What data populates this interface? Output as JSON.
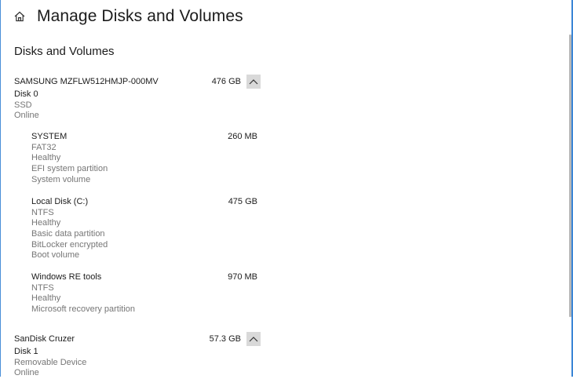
{
  "header": {
    "title": "Manage Disks and Volumes",
    "home_icon": "home-icon"
  },
  "section": {
    "title": "Disks and Volumes"
  },
  "disks": [
    {
      "name": "SAMSUNG MZFLW512HMJP-000MV",
      "size": "476 GB",
      "label": "Disk 0",
      "type": "SSD",
      "status": "Online",
      "volumes": [
        {
          "name": "SYSTEM",
          "size": "260 MB",
          "details": [
            "FAT32",
            "Healthy",
            "EFI system partition",
            "System volume"
          ]
        },
        {
          "name": "Local Disk (C:)",
          "size": "475 GB",
          "details": [
            "NTFS",
            "Healthy",
            "Basic data partition",
            "BitLocker encrypted",
            "Boot volume"
          ]
        },
        {
          "name": "Windows RE tools",
          "size": "970 MB",
          "details": [
            "NTFS",
            "Healthy",
            "Microsoft recovery partition"
          ]
        }
      ]
    },
    {
      "name": "SanDisk Cruzer",
      "size": "57.3 GB",
      "label": "Disk 1",
      "type": "Removable Device",
      "status": "Online",
      "volumes": []
    }
  ],
  "colors": {
    "accent": "#3b86d6",
    "secondary_text": "#767676",
    "button_bg": "#d9d9d9"
  }
}
